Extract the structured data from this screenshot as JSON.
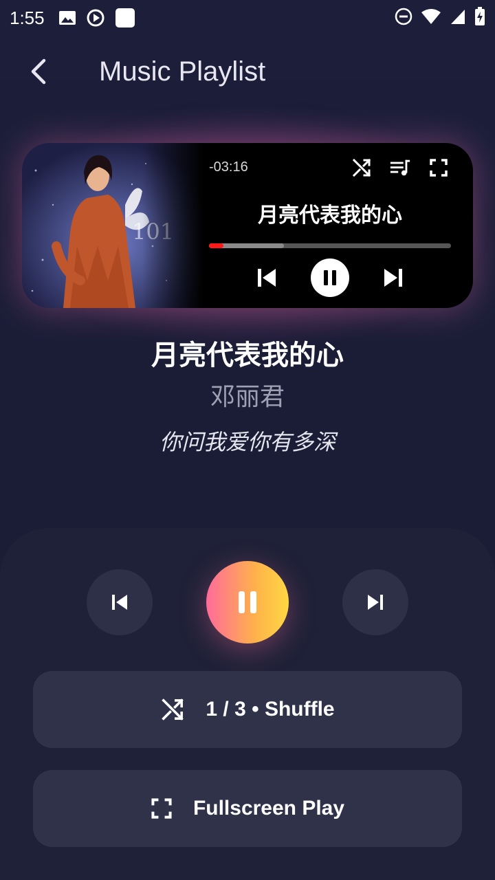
{
  "status_bar": {
    "time": "1:55",
    "left_icons": [
      "image-icon",
      "play-circle-icon",
      "square-icon"
    ],
    "right_icons": [
      "do-not-disturb-icon",
      "wifi-icon",
      "signal-icon",
      "battery-charging-icon"
    ]
  },
  "app_bar": {
    "title": "Music Playlist",
    "back_icon": "chevron-left-icon"
  },
  "mini_player": {
    "remaining_time": "-03:16",
    "title": "月亮代表我的心",
    "progress_played": 0.06,
    "progress_buffered": 0.31,
    "icons": [
      "shuffle-icon",
      "playlist-icon",
      "fullscreen-icon"
    ],
    "controls": [
      "skip-previous-icon",
      "pause-icon",
      "skip-next-icon"
    ],
    "accent_color": "#ff1a1a"
  },
  "song": {
    "title": "月亮代表我的心",
    "artist": "邓丽君",
    "lyric": "你问我爱你有多深"
  },
  "controls": {
    "prev_icon": "skip-previous-icon",
    "play_icon": "pause-icon",
    "next_icon": "skip-next-icon",
    "gradient": [
      "#ff6b9a",
      "#ffd844"
    ]
  },
  "shuffle_button": {
    "icon": "shuffle-icon",
    "label": "1 / 3 • Shuffle"
  },
  "fullscreen_button": {
    "icon": "fullscreen-icon",
    "label": "Fullscreen Play"
  }
}
